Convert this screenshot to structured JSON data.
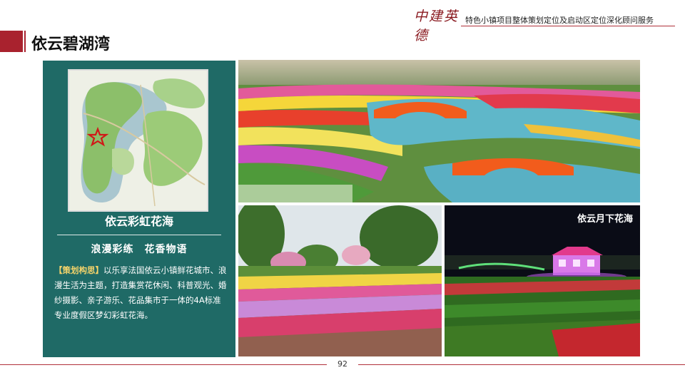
{
  "header": {
    "logo_text": "中建英德",
    "subtitle": "特色小镇项目整体策划定位及启动区定位深化顾问服务"
  },
  "page_title": "依云碧湖湾",
  "left_card": {
    "name": "依云彩虹花海",
    "slogan": "浪漫彩练　花香物语",
    "desc_lead": "【策划构思】",
    "desc_body": "以乐享法国依云小镇鲜花城市、浪漫生活为主题，打造集赏花休闲、科普观光、婚纱摄影、亲子游乐、花品集市于一体的4A标准专业度假区梦幻彩虹花海。"
  },
  "photos": {
    "night_label": "依云月下花海"
  },
  "page_number": "92",
  "colors": {
    "accent_red": "#a9222e",
    "panel_teal": "#1f6a66",
    "lead_yellow": "#f5d46a"
  }
}
